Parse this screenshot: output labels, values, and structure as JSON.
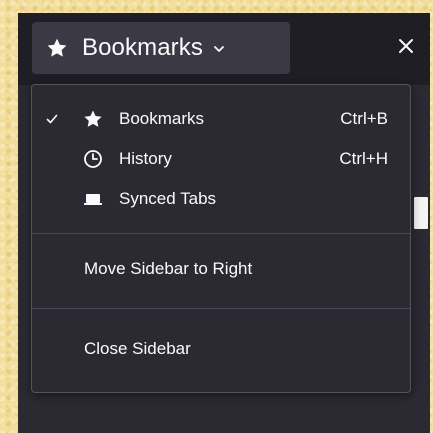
{
  "header": {
    "title": "Bookmarks",
    "title_icon": "star-icon",
    "dropdown_icon": "chevron-down-icon",
    "close_icon": "close-icon"
  },
  "menu": {
    "items": [
      {
        "label": "Bookmarks",
        "shortcut": "Ctrl+B",
        "icon": "star-icon",
        "checked": true
      },
      {
        "label": "History",
        "shortcut": "Ctrl+H",
        "icon": "clock-icon",
        "checked": false
      },
      {
        "label": "Synced Tabs",
        "icon": "synced-tabs-icon",
        "checked": false
      }
    ],
    "move_label": "Move Sidebar to Right",
    "close_label": "Close Sidebar"
  },
  "colors": {
    "sidebar_bg": "#2b2a33",
    "header_bg": "#1f1e25",
    "switcher_bg": "#3a3944",
    "text": "#fbfbfe",
    "separator": "#4a4853",
    "page_bg": "#f2dd9a"
  }
}
